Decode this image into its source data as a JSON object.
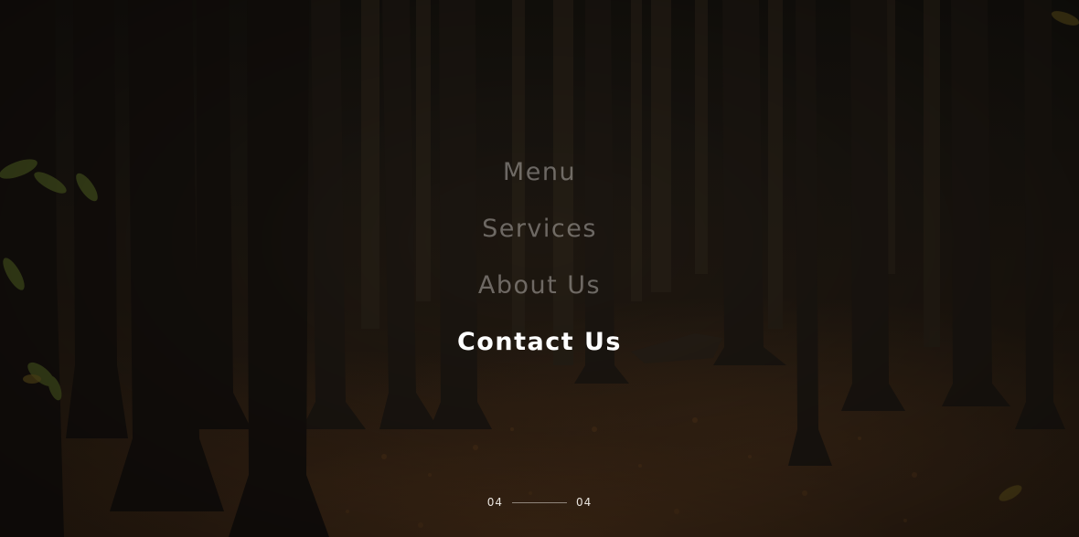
{
  "menu": {
    "items": [
      {
        "label": "Menu",
        "active": false
      },
      {
        "label": "Services",
        "active": false
      },
      {
        "label": "About Us",
        "active": false
      },
      {
        "label": "Contact Us",
        "active": true
      }
    ]
  },
  "pager": {
    "current": "04",
    "total": "04"
  },
  "colors": {
    "active_item": "#ffffff",
    "inactive_item": "#b9b4b0",
    "background": "#1d1812",
    "ground": "#2c1f13"
  }
}
